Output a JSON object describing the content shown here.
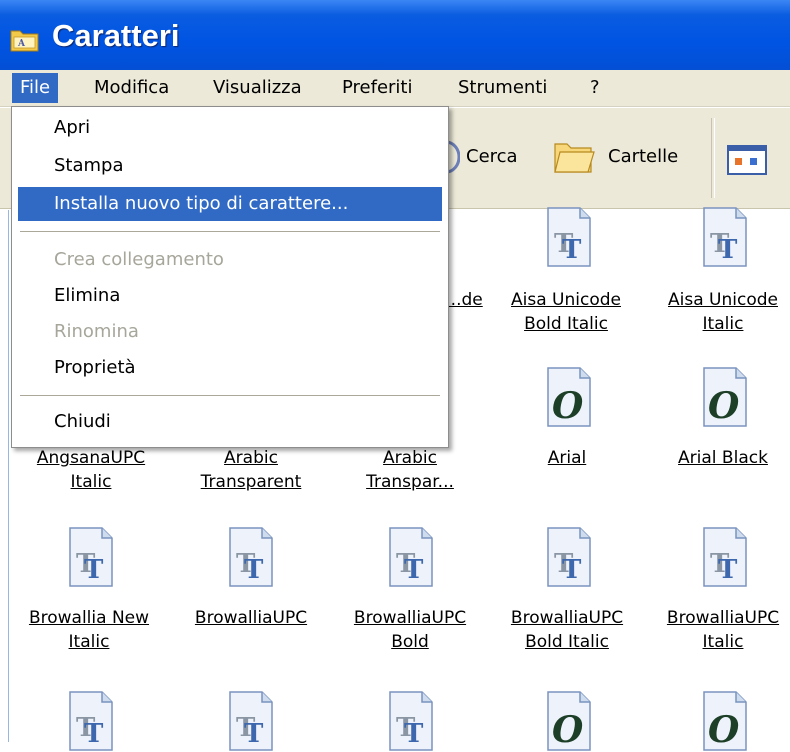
{
  "window": {
    "title": "Caratteri",
    "icon": "folder-fonts-icon"
  },
  "menubar": {
    "items": [
      {
        "label": "File",
        "active": true
      },
      {
        "label": "Modifica"
      },
      {
        "label": "Visualizza"
      },
      {
        "label": "Preferiti"
      },
      {
        "label": "Strumenti"
      },
      {
        "label": "?"
      }
    ]
  },
  "toolbar": {
    "search_label": "Cerca",
    "folders_label": "Cartelle"
  },
  "file_menu": {
    "items": [
      {
        "label": "Apri"
      },
      {
        "label": "Stampa"
      },
      {
        "label": "Installa nuovo tipo di carattere...",
        "highlighted": true
      },
      {
        "label": "Crea collegamento",
        "disabled": true
      },
      {
        "label": "Elimina"
      },
      {
        "label": "Rinomina",
        "disabled": true
      },
      {
        "label": "Proprietà"
      },
      {
        "label": "Chiudi"
      }
    ]
  },
  "fonts": {
    "row0": [
      {
        "lines": [
          "...de"
        ]
      },
      {
        "lines": [
          "Aisa Unicode",
          "Bold Italic"
        ],
        "type": "truetype"
      },
      {
        "lines": [
          "Aisa Unicode",
          "Italic"
        ],
        "type": "truetype"
      }
    ],
    "row1": [
      {
        "lines": [
          "AngsanaUPC",
          "Italic"
        ]
      },
      {
        "lines": [
          "Arabic",
          "Transparent"
        ]
      },
      {
        "lines": [
          "Arabic",
          "Transpar..."
        ]
      },
      {
        "lines": [
          "Arial"
        ],
        "type": "opentype"
      },
      {
        "lines": [
          "Arial Black"
        ],
        "type": "opentype"
      }
    ],
    "row2": [
      {
        "lines": [
          "Browallia New",
          "Italic"
        ],
        "type": "truetype"
      },
      {
        "lines": [
          "BrowalliaUPC"
        ],
        "type": "truetype"
      },
      {
        "lines": [
          "BrowalliaUPC",
          "Bold"
        ],
        "type": "truetype"
      },
      {
        "lines": [
          "BrowalliaUPC",
          "Bold Italic"
        ],
        "type": "truetype"
      },
      {
        "lines": [
          "BrowalliaUPC",
          "Italic"
        ],
        "type": "truetype"
      }
    ],
    "row3_types": [
      "truetype",
      "truetype",
      "truetype",
      "opentype",
      "opentype"
    ]
  },
  "colors": {
    "titlebar": "#0054e3",
    "highlight": "#316ac5",
    "menubar": "#ece9d8",
    "disabled": "#a7a69b"
  }
}
